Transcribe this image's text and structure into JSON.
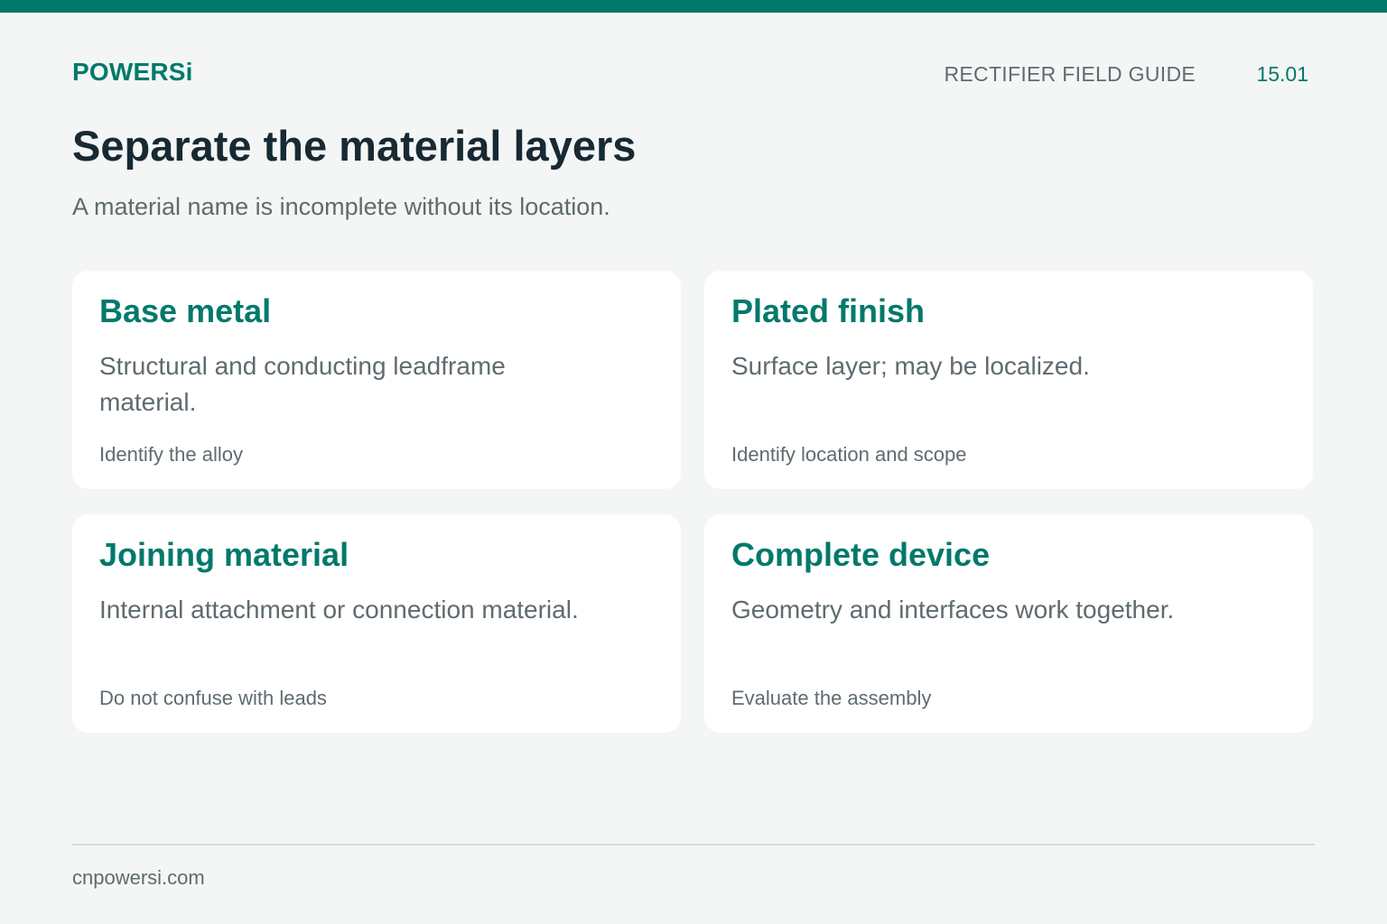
{
  "header": {
    "brand": "POWERSi",
    "guide_title": "RECTIFIER FIELD GUIDE",
    "page_number": "15.01"
  },
  "main": {
    "title": "Separate the material layers",
    "subtitle": "A material name is incomplete without its location.",
    "cards": [
      {
        "title": "Base metal",
        "description": "Structural and conducting leadframe material.",
        "note": "Identify the alloy"
      },
      {
        "title": "Plated finish",
        "description": "Surface layer; may be localized.",
        "note": "Identify location and scope"
      },
      {
        "title": "Joining material",
        "description": "Internal attachment or connection material.",
        "note": "Do not confuse with leads"
      },
      {
        "title": "Complete device",
        "description": "Geometry and interfaces work together.",
        "note": "Evaluate the assembly"
      }
    ]
  },
  "footer": {
    "url": "cnpowersi.com"
  },
  "colors": {
    "accent": "#00796b",
    "heading": "#172a33",
    "muted_text": "#5f6b70",
    "background": "#f4f6f5",
    "card": "#ffffff",
    "divider": "#cfe0da"
  }
}
